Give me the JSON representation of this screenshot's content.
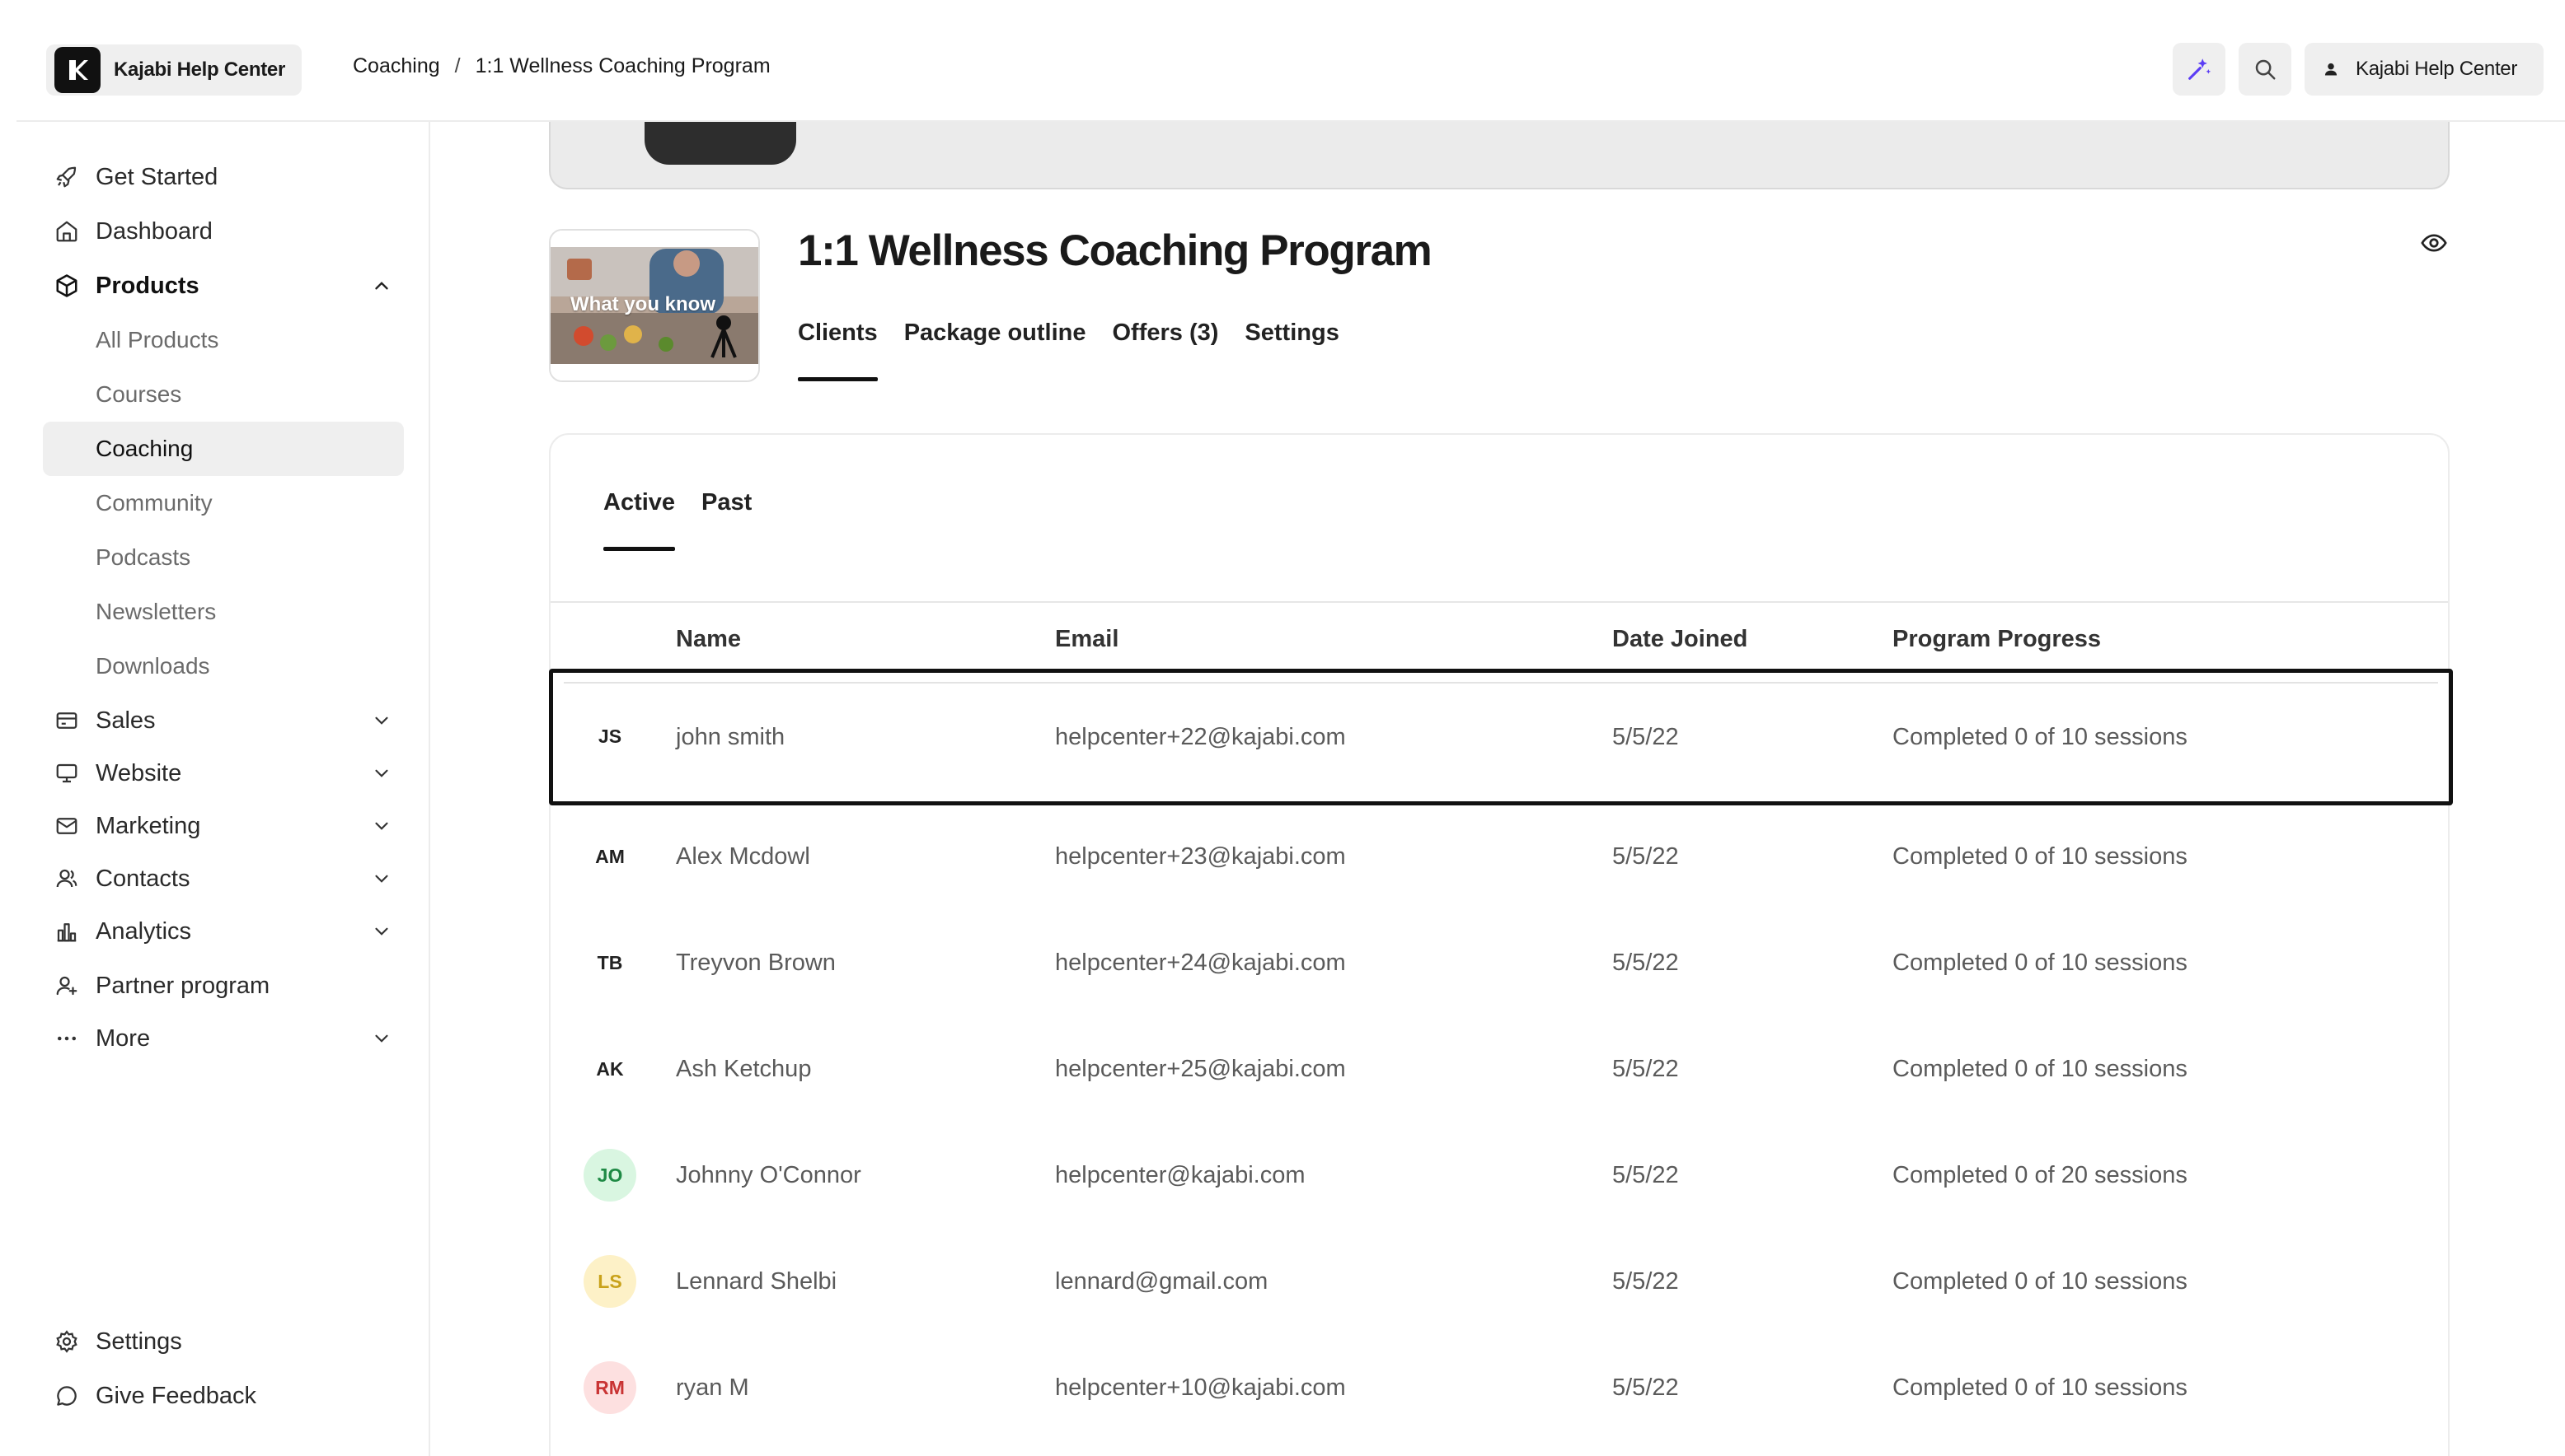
{
  "topbar": {
    "brand_name": "Kajabi Help Center",
    "breadcrumb": [
      "Coaching",
      "1:1 Wellness Coaching Program"
    ],
    "breadcrumb_sep": "/",
    "account_label": "Kajabi Help Center"
  },
  "sidebar": {
    "items": [
      {
        "label": "Get Started",
        "icon": "rocket-icon"
      },
      {
        "label": "Dashboard",
        "icon": "home-icon"
      },
      {
        "label": "Products",
        "icon": "cube-icon"
      },
      {
        "label": "Sales",
        "icon": "credit-card-icon"
      },
      {
        "label": "Website",
        "icon": "monitor-icon"
      },
      {
        "label": "Marketing",
        "icon": "mail-icon"
      },
      {
        "label": "Contacts",
        "icon": "users-icon"
      },
      {
        "label": "Analytics",
        "icon": "bar-chart-icon"
      },
      {
        "label": "Partner program",
        "icon": "user-plus-icon"
      },
      {
        "label": "More",
        "icon": "ellipsis-icon"
      }
    ],
    "products_sub": [
      "All Products",
      "Courses",
      "Coaching",
      "Community",
      "Podcasts",
      "Newsletters",
      "Downloads"
    ],
    "bottom": [
      {
        "label": "Settings",
        "icon": "gear-icon"
      },
      {
        "label": "Give Feedback",
        "icon": "chat-bubble-icon"
      }
    ]
  },
  "product": {
    "title": "1:1 Wellness Coaching Program",
    "thumbnail_text": "What you know",
    "tabs": [
      "Clients",
      "Package outline",
      "Offers (3)",
      "Settings"
    ]
  },
  "clients": {
    "tabs": [
      "Active",
      "Past"
    ],
    "columns": [
      "Name",
      "Email",
      "Date Joined",
      "Program Progress"
    ],
    "rows": [
      {
        "initials": "JS",
        "name": "john smith",
        "email": "helpcenter+22@kajabi.com",
        "date": "5/5/22",
        "progress": "Completed 0 of 10 sessions",
        "avatar_bg": "#ffffff",
        "avatar_fg": "#222222"
      },
      {
        "initials": "AM",
        "name": "Alex Mcdowl",
        "email": "helpcenter+23@kajabi.com",
        "date": "5/5/22",
        "progress": "Completed 0 of 10 sessions",
        "avatar_bg": "#ffffff",
        "avatar_fg": "#222222"
      },
      {
        "initials": "TB",
        "name": "Treyvon Brown",
        "email": "helpcenter+24@kajabi.com",
        "date": "5/5/22",
        "progress": "Completed 0 of 10 sessions",
        "avatar_bg": "#ffffff",
        "avatar_fg": "#222222"
      },
      {
        "initials": "AK",
        "name": "Ash Ketchup",
        "email": "helpcenter+25@kajabi.com",
        "date": "5/5/22",
        "progress": "Completed 0 of 10 sessions",
        "avatar_bg": "#ffffff",
        "avatar_fg": "#222222"
      },
      {
        "initials": "JO",
        "name": "Johnny O'Connor",
        "email": "helpcenter@kajabi.com",
        "date": "5/5/22",
        "progress": "Completed 0 of 20 sessions",
        "avatar_bg": "#d9f6e1",
        "avatar_fg": "#1f8a45"
      },
      {
        "initials": "LS",
        "name": "Lennard Shelbi",
        "email": "lennard@gmail.com",
        "date": "5/5/22",
        "progress": "Completed 0 of 10 sessions",
        "avatar_bg": "#fdf1c7",
        "avatar_fg": "#c9a21a"
      },
      {
        "initials": "RM",
        "name": "ryan M",
        "email": "helpcenter+10@kajabi.com",
        "date": "5/5/22",
        "progress": "Completed 0 of 10 sessions",
        "avatar_bg": "#fde0e0",
        "avatar_fg": "#c93434"
      }
    ]
  },
  "colors": {
    "accent": "#5b3df5",
    "text": "#1c1c1c",
    "muted": "#6b6b6b"
  }
}
